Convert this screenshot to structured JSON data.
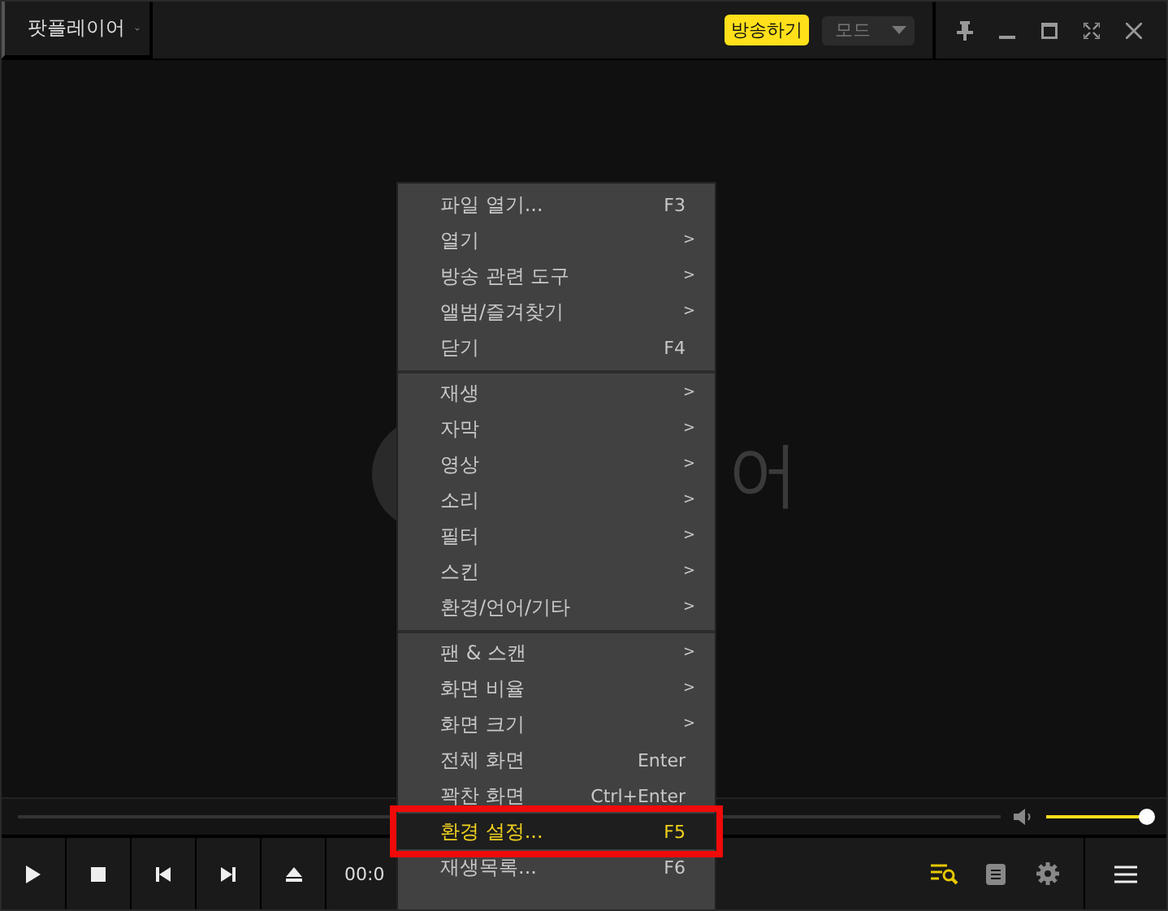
{
  "title_bar": {
    "app_name": "팟플레이어",
    "broadcast_button": "방송하기",
    "mode_dropdown": "모드"
  },
  "background_logo": {
    "text": "어"
  },
  "context_menu": {
    "sections": [
      [
        {
          "label": "파일 열기...",
          "hint": "F3",
          "kind": "shortcut",
          "selected": false
        },
        {
          "label": "열기",
          "hint": ">",
          "kind": "submenu",
          "selected": false
        },
        {
          "label": "방송 관련 도구",
          "hint": ">",
          "kind": "submenu",
          "selected": false
        },
        {
          "label": "앨범/즐겨찾기",
          "hint": ">",
          "kind": "submenu",
          "selected": false
        },
        {
          "label": "닫기",
          "hint": "F4",
          "kind": "shortcut",
          "selected": false
        }
      ],
      [
        {
          "label": "재생",
          "hint": ">",
          "kind": "submenu",
          "selected": false
        },
        {
          "label": "자막",
          "hint": ">",
          "kind": "submenu",
          "selected": false
        },
        {
          "label": "영상",
          "hint": ">",
          "kind": "submenu",
          "selected": false
        },
        {
          "label": "소리",
          "hint": ">",
          "kind": "submenu",
          "selected": false
        },
        {
          "label": "필터",
          "hint": ">",
          "kind": "submenu",
          "selected": false
        },
        {
          "label": "스킨",
          "hint": ">",
          "kind": "submenu",
          "selected": false
        },
        {
          "label": "환경/언어/기타",
          "hint": ">",
          "kind": "submenu",
          "selected": false
        }
      ],
      [
        {
          "label": "팬 & 스캔",
          "hint": ">",
          "kind": "submenu",
          "selected": false
        },
        {
          "label": "화면 비율",
          "hint": ">",
          "kind": "submenu",
          "selected": false
        },
        {
          "label": "화면 크기",
          "hint": ">",
          "kind": "submenu",
          "selected": false
        },
        {
          "label": "전체 화면",
          "hint": "Enter",
          "kind": "shortcut",
          "selected": false
        },
        {
          "label": "꽉찬 화면",
          "hint": "Ctrl+Enter",
          "kind": "shortcut",
          "selected": false
        },
        {
          "label": "환경 설정...",
          "hint": "F5",
          "kind": "shortcut",
          "selected": true
        },
        {
          "label": "재생목록...",
          "hint": "F6",
          "kind": "shortcut",
          "selected": false
        }
      ]
    ]
  },
  "volume": {
    "level": 0.97
  },
  "controls": {
    "time": "00:0"
  }
}
